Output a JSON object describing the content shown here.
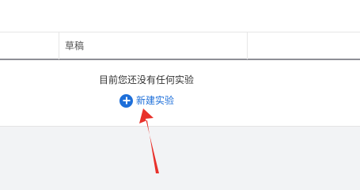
{
  "tabs": {
    "draft_label": "草稿"
  },
  "empty_state": {
    "message": "目前您还没有任何实验",
    "new_button_label": "新建实验",
    "new_button_icon": "plus-circle-icon"
  },
  "colors": {
    "accent": "#1e6fd9",
    "annotation": "#e8312b",
    "background": "#f2f3f5"
  }
}
